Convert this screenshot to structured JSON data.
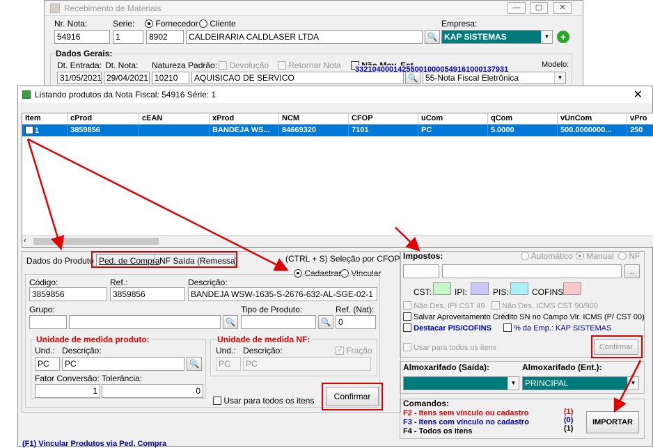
{
  "background_window": {
    "title": "Recebimento de Materiais",
    "nr_nota_label": "Nr. Nota:",
    "nr_nota": "54916",
    "serie_label": "Serie:",
    "serie": "1",
    "tipo_fornecedor": "Fornecedor",
    "tipo_cliente": "Cliente",
    "fornecedor_codigo": "8902",
    "fornecedor_nome": "CALDEIRARIA CALDLASER LTDA",
    "empresa_label": "Empresa:",
    "empresa": "KAP SISTEMAS",
    "dados_gerais_label": "Dados Gerais:",
    "dt_entrada_label": "Dt. Entrada:",
    "dt_entrada": "31/05/2021",
    "dt_nota_label": "Dt. Nota:",
    "dt_nota": "29/04/2021",
    "natureza_label": "Natureza Padrão:",
    "natureza_codigo": "10210",
    "natureza_desc": "AQUISICAO DE SERVICO",
    "devolucao_label": "Devolução",
    "retornar_label": "Retornar Nota",
    "nao_mov_label": "Não Mov. Est.",
    "modelo_label": "Modelo:",
    "chave": "33210400014255001000054916100013793​1",
    "modelo": "55-Nota Fiscal Eletrônica"
  },
  "modal": {
    "title": "Listando produtos da Nota Fiscal: 54916 Série: 1",
    "grid": {
      "columns": [
        "Item",
        "cProd",
        "cEAN",
        "xProd",
        "NCM",
        "CFOP",
        "uCom",
        "qCom",
        "vUnCom",
        "vPro"
      ],
      "rows": [
        [
          "1",
          "3859856",
          "",
          "BANDEJA WS...",
          "84669320",
          "7101",
          "PC",
          "5.0000",
          "500.0000000...",
          "250"
        ]
      ]
    },
    "tabs": [
      "Dados do Produto",
      "Ped. de Compra",
      "NF Saída (Remessa)"
    ],
    "selecao_cfop": "(CTRL + S) Seleção por CFOP",
    "cadastrar_label": "Cadastrar",
    "vincular_label": "Vincular",
    "produto": {
      "codigo_label": "Código:",
      "codigo": "3859856",
      "ref_label": "Ref.:",
      "ref": "3859856",
      "descricao_label": "Descrição:",
      "descricao": "BANDEJA WSW-1635-S-2676-632-AL-SGE-02-1",
      "grupo_label": "Grupo:",
      "grupo": "",
      "tipo_label": "Tipo de Produto:",
      "ref_nat_label": "Ref. (Nat):",
      "ref_nat": "0",
      "um_produto_label": "Unidade de medida produto:",
      "und_label": "Und.:",
      "und": "PC",
      "und_desc_label": "Descrição:",
      "und_desc": "PC",
      "fator_label": "Fator Conversão:",
      "fator": "1",
      "tolerancia_label": "Tolerância:",
      "tolerancia": "0",
      "um_nf_label": "Unidade de medida NF:",
      "nf_und_label": "Und.:",
      "nf_und": "PC",
      "nf_desc_label": "Descrição:",
      "nf_desc": "PC",
      "fracao_label": "Fração",
      "usar_todos_label": "Usar para todos os itens",
      "confirmar": "Confirmar"
    },
    "impostos": {
      "label": "Impostos:",
      "automatico": "Automático",
      "manual": "Manual",
      "nf": "NF",
      "cst": "CST:",
      "ipi": "IPI:",
      "pis": "PIS:",
      "cofins": "COFINS:",
      "nao_des_ipi": "Não Des. IPI CST 49",
      "nao_des_icms": "Não Des. ICMS CST 90/900",
      "salvar_aprov": "Salvar Aproveitamento Crédito SN no Campo Vlr. ICMS (P/ CST 00)",
      "destacar": "Destacar PIS/COFINS",
      "pct_emp": "% da Emp.: KAP SISTEMAS",
      "usar_todos": "Usar para todos os itens",
      "confirmar": "Confirmar",
      "colors": {
        "cst": "#c8f5c8",
        "ipi": "#c8c8f8",
        "pis": "#a8f0f8",
        "cofins": "#f8c8c8"
      }
    },
    "almox": {
      "saida_label": "Almoxarifado (Saída):",
      "saida": "",
      "ent_label": "Almoxarifado (Ent.):",
      "ent": "PRINCIPAL"
    },
    "comandos": {
      "label": "Comandos:",
      "f2": "F2 - Itens sem vínculo ou cadastro",
      "f2_count": "(1)",
      "f3": "F3 - Itens com vínculo no cadastro",
      "f3_count": "(0)",
      "f4": "F4 - Todos os itens",
      "f4_count": "(1)",
      "importar": "IMPORTAR"
    },
    "footer": "(F1) Vincular Produtos via Ped. Compra"
  },
  "colors": {
    "selection": "#0078d7",
    "teal": "#007b7b",
    "annotation": "#e00000"
  }
}
